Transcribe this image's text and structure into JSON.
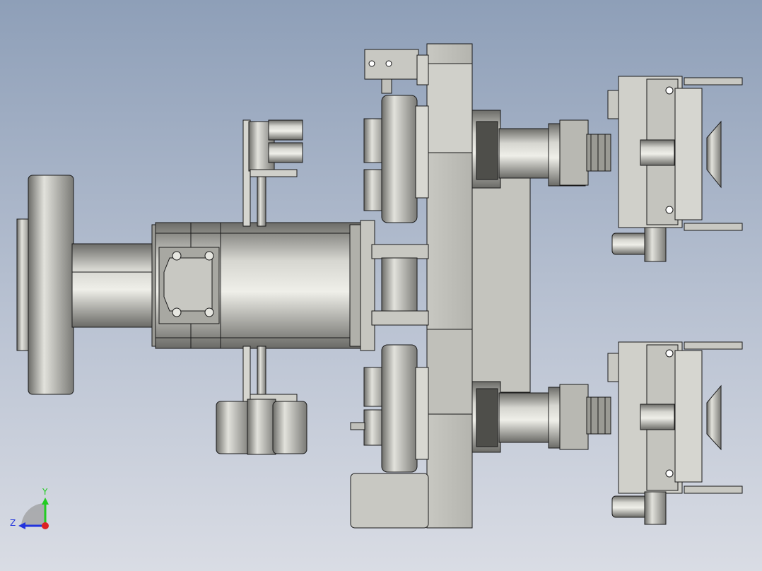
{
  "viewport": {
    "background_top": "#8e9fb8",
    "background_bottom": "#d9dce4"
  },
  "model": {
    "icon": "cad-assembly-model",
    "shade_light": "#d8d8d2",
    "shade_mid": "#b4b4ae",
    "shade_dark": "#5e5e5a",
    "edge_color": "#1a1a1a"
  },
  "triad": {
    "icon": "coordinate-triad-icon",
    "y_label": "Y",
    "z_label": "Z",
    "y_color": "#22cc22",
    "z_color": "#2233dd",
    "x_color": "#dd2222"
  }
}
